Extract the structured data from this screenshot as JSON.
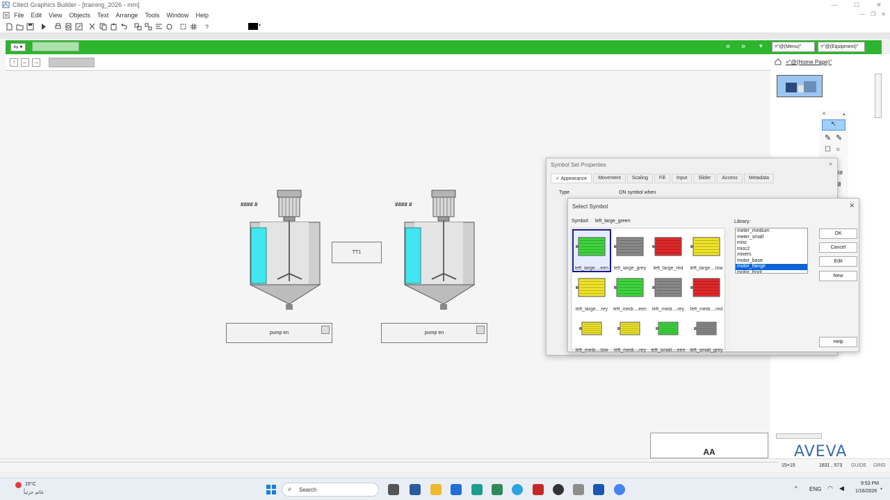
{
  "window": {
    "title": "Citect Graphics Builder - [training_2026 - mm]"
  },
  "menu": [
    "File",
    "Edit",
    "View",
    "Objects",
    "Text",
    "Arrange",
    "Tools",
    "Window",
    "Help"
  ],
  "header_nav": {
    "prev": "«",
    "next": "»"
  },
  "right_links": {
    "menu": "=\"@(Menu)\"",
    "equipment": "=\"@(Equipment)\"",
    "home": "=\"@(Home Page)\""
  },
  "tanks": [
    {
      "label": "#### #",
      "button": "pump en"
    },
    {
      "label": "#### #",
      "button": "pump en"
    }
  ],
  "transmitter": {
    "label": "TT1"
  },
  "aa_box": {
    "label": "AA"
  },
  "brand": "AVEVA",
  "symbol_set": {
    "title": "Symbol Set Properties",
    "tabs": [
      "Appearance",
      "Movement",
      "Scaling",
      "Fill",
      "Input",
      "Slider",
      "Access",
      "Metadata"
    ],
    "type_label": "Type",
    "on_symbol_label": "ON symbol when"
  },
  "select_symbol": {
    "title": "Select Symbol",
    "symbol_label": "Symbol:",
    "symbol_value": "left_large_green",
    "library_label": "Library:",
    "library_items": [
      "meter_medium",
      "meter_small",
      "misc",
      "misc2",
      "mixers",
      "motor_base",
      "motor_flange",
      "motor_front"
    ],
    "selected_library": "motor_flange",
    "buttons": {
      "ok": "OK",
      "cancel": "Cancel",
      "edit": "Edit",
      "new": "New",
      "help": "Help"
    },
    "tiles": [
      {
        "caption": "left_large....een",
        "color": "#3ed63e"
      },
      {
        "caption": "left_large_grey",
        "color": "#8a8a8a"
      },
      {
        "caption": "left_large_red",
        "color": "#e0282a"
      },
      {
        "caption": "left_large....low",
        "color": "#f1e52a"
      },
      {
        "caption": "left_large....rey",
        "color": "#f1e52a"
      },
      {
        "caption": "left_medi....een",
        "color": "#3ed63e"
      },
      {
        "caption": "left_medi....rey",
        "color": "#8a8a8a"
      },
      {
        "caption": "left_medi....red",
        "color": "#e0282a"
      },
      {
        "caption": "left_medi....low",
        "color": "#f1e52a"
      },
      {
        "caption": "left_medi....rey",
        "color": "#f1e52a"
      },
      {
        "caption": "left_small....een",
        "color": "#3ed63e"
      },
      {
        "caption": "left_small_grey",
        "color": "#8a8a8a"
      }
    ]
  },
  "status": {
    "grid_size": "15×15",
    "coords": "1831 , 573",
    "guide": "GUIDE",
    "grid": "GRID"
  },
  "taskbar": {
    "weather_temp": "15°C",
    "weather_desc": "غائم جزئياً",
    "search_placeholder": "Search",
    "lang": "ENG",
    "time": "9:53 PM",
    "date": "1/16/2026"
  },
  "colors": {
    "accent_green": "#2db52d",
    "tank_liquid": "#41e6ef",
    "selection_blue": "#0a64d8"
  }
}
